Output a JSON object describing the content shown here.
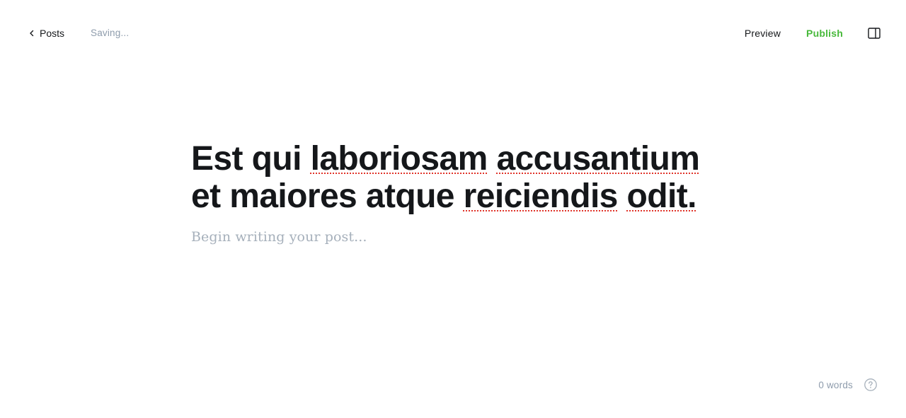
{
  "header": {
    "back_label": "Posts",
    "status": "Saving...",
    "preview_label": "Preview",
    "publish_label": "Publish",
    "icons": {
      "back": "chevron-left-icon",
      "sidebar": "sidebar-toggle-icon"
    }
  },
  "editor": {
    "title_words": [
      "Est",
      "qui",
      "laboriosam",
      "accusantium",
      "et",
      "maiores",
      "atque",
      "reiciendis",
      "odit."
    ],
    "body_placeholder": "Begin writing your post..."
  },
  "footer": {
    "word_count": "0 words",
    "help_icon": "help-circle-icon"
  },
  "colors": {
    "text": "#15171a",
    "muted": "#8e9cac",
    "publish": "#48b93b",
    "spellcheck": "#e0342a"
  }
}
